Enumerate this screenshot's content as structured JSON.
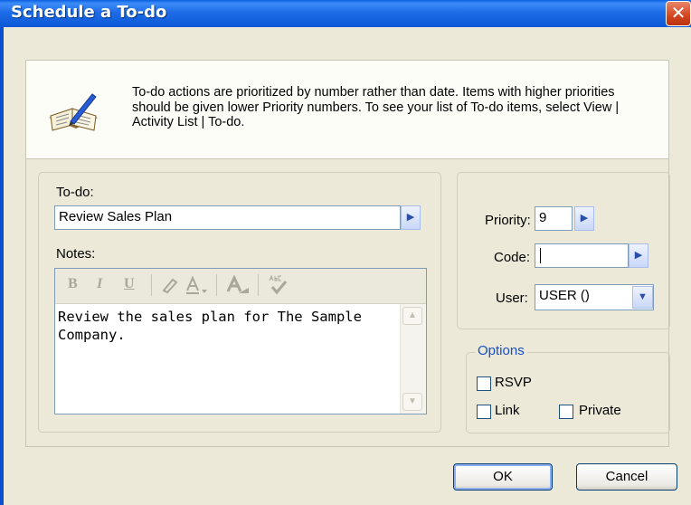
{
  "window": {
    "title": "Schedule a To-do",
    "close_glyph": "✕"
  },
  "description": "To-do actions are prioritized by number rather than date.  Items with higher priorities should be given lower Priority numbers.   To see your list of To-do items, select View | Activity List | To-do.",
  "todo": {
    "label": "To-do:",
    "value": "Review Sales Plan"
  },
  "notes": {
    "label": "Notes:",
    "text": "Review the sales plan for The Sample Company.",
    "toolbar": [
      "B",
      "I",
      "U",
      "highlight-icon",
      "font-color-icon",
      "font-size-icon",
      "spell-check-icon"
    ]
  },
  "priority": {
    "label": "Priority:",
    "value": "9"
  },
  "code": {
    "label": "Code:",
    "value": ""
  },
  "user": {
    "label": "User:",
    "value": "USER ()"
  },
  "options": {
    "legend": "Options",
    "rsvp": {
      "label": "RSVP",
      "checked": false
    },
    "link": {
      "label": "Link",
      "checked": false
    },
    "private": {
      "label": "Private",
      "checked": false
    }
  },
  "buttons": {
    "ok": "OK",
    "cancel": "Cancel"
  },
  "colors": {
    "titlebar": "#0a58d6",
    "options_legend": "#1650c8",
    "dialog_bg": "#ece9d8"
  }
}
